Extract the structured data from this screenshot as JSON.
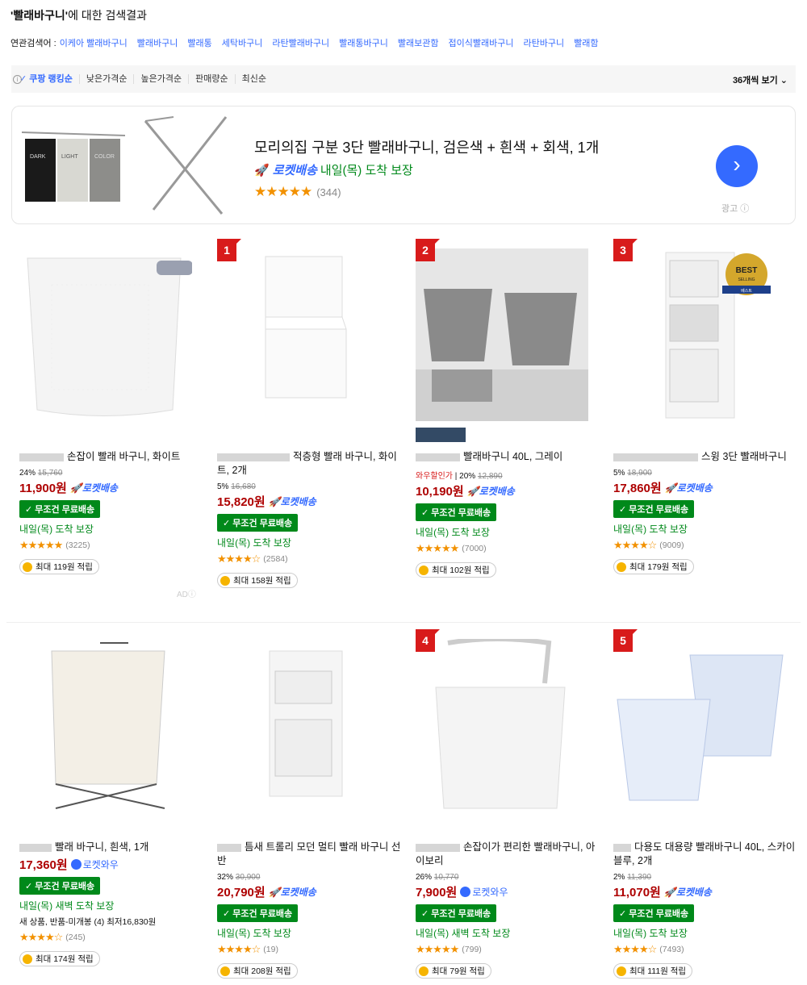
{
  "search": {
    "query": "'빨래바구니'",
    "suffix": "에 대한 검색결과"
  },
  "related": {
    "label": "연관검색어 :",
    "terms": [
      "이케아 빨래바구니",
      "빨래바구니",
      "빨래통",
      "세탁바구니",
      "라탄빨래바구니",
      "빨래통바구니",
      "빨래보관함",
      "접이식빨래바구니",
      "라탄바구니",
      "빨래함"
    ]
  },
  "sort": {
    "options": [
      "쿠팡 랭킹순",
      "낮은가격순",
      "높은가격순",
      "판매량순",
      "최신순"
    ],
    "view": "36개씩 보기"
  },
  "ad": {
    "name": "모리의집 구분 3단 빨래바구니, 검은색 + 흰색 + 회색, 1개",
    "rocket": "로켓배송",
    "delivery": "내일(목) 도착 보장",
    "reviews": "(344)",
    "ad_label": "광고",
    "img_labels": [
      "DARK",
      "LIGHT",
      "COLOR"
    ]
  },
  "products": [
    {
      "rank": "",
      "name": "손잡이 빨래 바구니, 화이트",
      "disc": "24%",
      "orig": "15,760",
      "wow": "",
      "price": "11,900원",
      "badge": "로켓배송",
      "free": "무조건 무료배송",
      "delivery": "내일(목) 도착 보장",
      "newp": "",
      "reviews": "(3225)",
      "stars": "★★★★★",
      "points": "최대 119원 적립",
      "ad": "AD"
    },
    {
      "rank": "1",
      "name": "적층형 빨래 바구니, 화이트, 2개",
      "disc": "5%",
      "orig": "16,680",
      "wow": "",
      "price": "15,820원",
      "badge": "로켓배송",
      "free": "무조건 무료배송",
      "delivery": "내일(목) 도착 보장",
      "newp": "",
      "reviews": "(2584)",
      "stars": "★★★★☆",
      "points": "최대 158원 적립",
      "ad": ""
    },
    {
      "rank": "2",
      "name": "빨래바구니 40L, 그레이",
      "disc": "20%",
      "orig": "12,890",
      "wow": "와우할인가",
      "price": "10,190원",
      "badge": "로켓배송",
      "free": "무조건 무료배송",
      "delivery": "내일(목) 도착 보장",
      "newp": "",
      "reviews": "(7000)",
      "stars": "★★★★★",
      "points": "최대 102원 적립",
      "ad": ""
    },
    {
      "rank": "3",
      "name": "스윙 3단 빨래바구니",
      "disc": "5%",
      "orig": "18,900",
      "wow": "",
      "price": "17,860원",
      "badge": "로켓배송",
      "free": "무조건 무료배송",
      "delivery": "내일(목) 도착 보장",
      "newp": "",
      "reviews": "(9009)",
      "stars": "★★★★☆",
      "points": "최대 179원 적립",
      "ad": ""
    },
    {
      "rank": "",
      "name": "빨래 바구니, 흰색, 1개",
      "disc": "",
      "orig": "",
      "wow": "",
      "price": "17,360원",
      "badge": "로켓와우",
      "free": "무조건 무료배송",
      "delivery": "내일(목) 새벽 도착 보장",
      "newp": "새 상품, 반품-미개봉 (4) 최저16,830원",
      "reviews": "(245)",
      "stars": "★★★★☆",
      "points": "최대 174원 적립",
      "ad": ""
    },
    {
      "rank": "",
      "name": "틈새 트롤리 모던 멀티 빨래 바구니 선반",
      "disc": "32%",
      "orig": "30,900",
      "wow": "",
      "price": "20,790원",
      "badge": "로켓배송",
      "free": "무조건 무료배송",
      "delivery": "내일(목) 도착 보장",
      "newp": "",
      "reviews": "(19)",
      "stars": "★★★★☆",
      "points": "최대 208원 적립",
      "ad": ""
    },
    {
      "rank": "4",
      "name": "손잡이가 편리한 빨래바구니, 아이보리",
      "disc": "26%",
      "orig": "10,770",
      "wow": "",
      "price": "7,900원",
      "badge": "로켓와우",
      "free": "무조건 무료배송",
      "delivery": "내일(목) 새벽 도착 보장",
      "newp": "",
      "reviews": "(799)",
      "stars": "★★★★★",
      "points": "최대 79원 적립",
      "ad": ""
    },
    {
      "rank": "5",
      "name": "다용도 대용량 빨래바구니 40L, 스카이블루, 2개",
      "disc": "2%",
      "orig": "11,390",
      "wow": "",
      "price": "11,070원",
      "badge": "로켓배송",
      "free": "무조건 무료배송",
      "delivery": "내일(목) 도착 보장",
      "newp": "",
      "reviews": "(7493)",
      "stars": "★★★★☆",
      "points": "최대 111원 적립",
      "ad": ""
    }
  ],
  "best_badge": {
    "top": "BEST",
    "mid": "SELLING",
    "bottom": "베스트"
  }
}
